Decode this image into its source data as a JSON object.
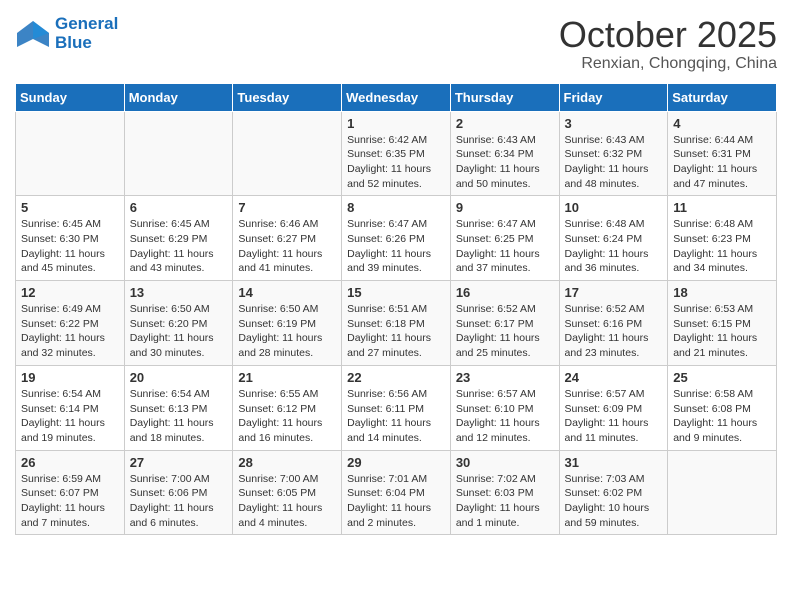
{
  "header": {
    "logo_line1": "General",
    "logo_line2": "Blue",
    "month": "October 2025",
    "location": "Renxian, Chongqing, China"
  },
  "days_of_week": [
    "Sunday",
    "Monday",
    "Tuesday",
    "Wednesday",
    "Thursday",
    "Friday",
    "Saturday"
  ],
  "weeks": [
    [
      {
        "day": "",
        "content": ""
      },
      {
        "day": "",
        "content": ""
      },
      {
        "day": "",
        "content": ""
      },
      {
        "day": "1",
        "content": "Sunrise: 6:42 AM\nSunset: 6:35 PM\nDaylight: 11 hours\nand 52 minutes."
      },
      {
        "day": "2",
        "content": "Sunrise: 6:43 AM\nSunset: 6:34 PM\nDaylight: 11 hours\nand 50 minutes."
      },
      {
        "day": "3",
        "content": "Sunrise: 6:43 AM\nSunset: 6:32 PM\nDaylight: 11 hours\nand 48 minutes."
      },
      {
        "day": "4",
        "content": "Sunrise: 6:44 AM\nSunset: 6:31 PM\nDaylight: 11 hours\nand 47 minutes."
      }
    ],
    [
      {
        "day": "5",
        "content": "Sunrise: 6:45 AM\nSunset: 6:30 PM\nDaylight: 11 hours\nand 45 minutes."
      },
      {
        "day": "6",
        "content": "Sunrise: 6:45 AM\nSunset: 6:29 PM\nDaylight: 11 hours\nand 43 minutes."
      },
      {
        "day": "7",
        "content": "Sunrise: 6:46 AM\nSunset: 6:27 PM\nDaylight: 11 hours\nand 41 minutes."
      },
      {
        "day": "8",
        "content": "Sunrise: 6:47 AM\nSunset: 6:26 PM\nDaylight: 11 hours\nand 39 minutes."
      },
      {
        "day": "9",
        "content": "Sunrise: 6:47 AM\nSunset: 6:25 PM\nDaylight: 11 hours\nand 37 minutes."
      },
      {
        "day": "10",
        "content": "Sunrise: 6:48 AM\nSunset: 6:24 PM\nDaylight: 11 hours\nand 36 minutes."
      },
      {
        "day": "11",
        "content": "Sunrise: 6:48 AM\nSunset: 6:23 PM\nDaylight: 11 hours\nand 34 minutes."
      }
    ],
    [
      {
        "day": "12",
        "content": "Sunrise: 6:49 AM\nSunset: 6:22 PM\nDaylight: 11 hours\nand 32 minutes."
      },
      {
        "day": "13",
        "content": "Sunrise: 6:50 AM\nSunset: 6:20 PM\nDaylight: 11 hours\nand 30 minutes."
      },
      {
        "day": "14",
        "content": "Sunrise: 6:50 AM\nSunset: 6:19 PM\nDaylight: 11 hours\nand 28 minutes."
      },
      {
        "day": "15",
        "content": "Sunrise: 6:51 AM\nSunset: 6:18 PM\nDaylight: 11 hours\nand 27 minutes."
      },
      {
        "day": "16",
        "content": "Sunrise: 6:52 AM\nSunset: 6:17 PM\nDaylight: 11 hours\nand 25 minutes."
      },
      {
        "day": "17",
        "content": "Sunrise: 6:52 AM\nSunset: 6:16 PM\nDaylight: 11 hours\nand 23 minutes."
      },
      {
        "day": "18",
        "content": "Sunrise: 6:53 AM\nSunset: 6:15 PM\nDaylight: 11 hours\nand 21 minutes."
      }
    ],
    [
      {
        "day": "19",
        "content": "Sunrise: 6:54 AM\nSunset: 6:14 PM\nDaylight: 11 hours\nand 19 minutes."
      },
      {
        "day": "20",
        "content": "Sunrise: 6:54 AM\nSunset: 6:13 PM\nDaylight: 11 hours\nand 18 minutes."
      },
      {
        "day": "21",
        "content": "Sunrise: 6:55 AM\nSunset: 6:12 PM\nDaylight: 11 hours\nand 16 minutes."
      },
      {
        "day": "22",
        "content": "Sunrise: 6:56 AM\nSunset: 6:11 PM\nDaylight: 11 hours\nand 14 minutes."
      },
      {
        "day": "23",
        "content": "Sunrise: 6:57 AM\nSunset: 6:10 PM\nDaylight: 11 hours\nand 12 minutes."
      },
      {
        "day": "24",
        "content": "Sunrise: 6:57 AM\nSunset: 6:09 PM\nDaylight: 11 hours\nand 11 minutes."
      },
      {
        "day": "25",
        "content": "Sunrise: 6:58 AM\nSunset: 6:08 PM\nDaylight: 11 hours\nand 9 minutes."
      }
    ],
    [
      {
        "day": "26",
        "content": "Sunrise: 6:59 AM\nSunset: 6:07 PM\nDaylight: 11 hours\nand 7 minutes."
      },
      {
        "day": "27",
        "content": "Sunrise: 7:00 AM\nSunset: 6:06 PM\nDaylight: 11 hours\nand 6 minutes."
      },
      {
        "day": "28",
        "content": "Sunrise: 7:00 AM\nSunset: 6:05 PM\nDaylight: 11 hours\nand 4 minutes."
      },
      {
        "day": "29",
        "content": "Sunrise: 7:01 AM\nSunset: 6:04 PM\nDaylight: 11 hours\nand 2 minutes."
      },
      {
        "day": "30",
        "content": "Sunrise: 7:02 AM\nSunset: 6:03 PM\nDaylight: 11 hours\nand 1 minute."
      },
      {
        "day": "31",
        "content": "Sunrise: 7:03 AM\nSunset: 6:02 PM\nDaylight: 10 hours\nand 59 minutes."
      },
      {
        "day": "",
        "content": ""
      }
    ]
  ]
}
